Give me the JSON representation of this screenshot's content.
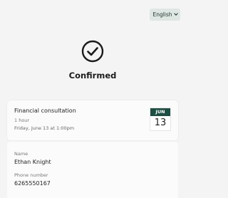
{
  "language": {
    "label": "English"
  },
  "status": {
    "icon": "check-circle-icon",
    "title": "Confirmed"
  },
  "booking": {
    "service": "Financial consultation",
    "duration": "1 hour",
    "datetime": "Friday, June 13 at 1:00pm",
    "calendar": {
      "month": "JUN",
      "day": "13",
      "accent_color": "#1e4e43"
    }
  },
  "contact": {
    "name_label": "Name",
    "name_value": "Ethan Knight",
    "phone_label": "Phone number",
    "phone_value": "6265550167"
  }
}
